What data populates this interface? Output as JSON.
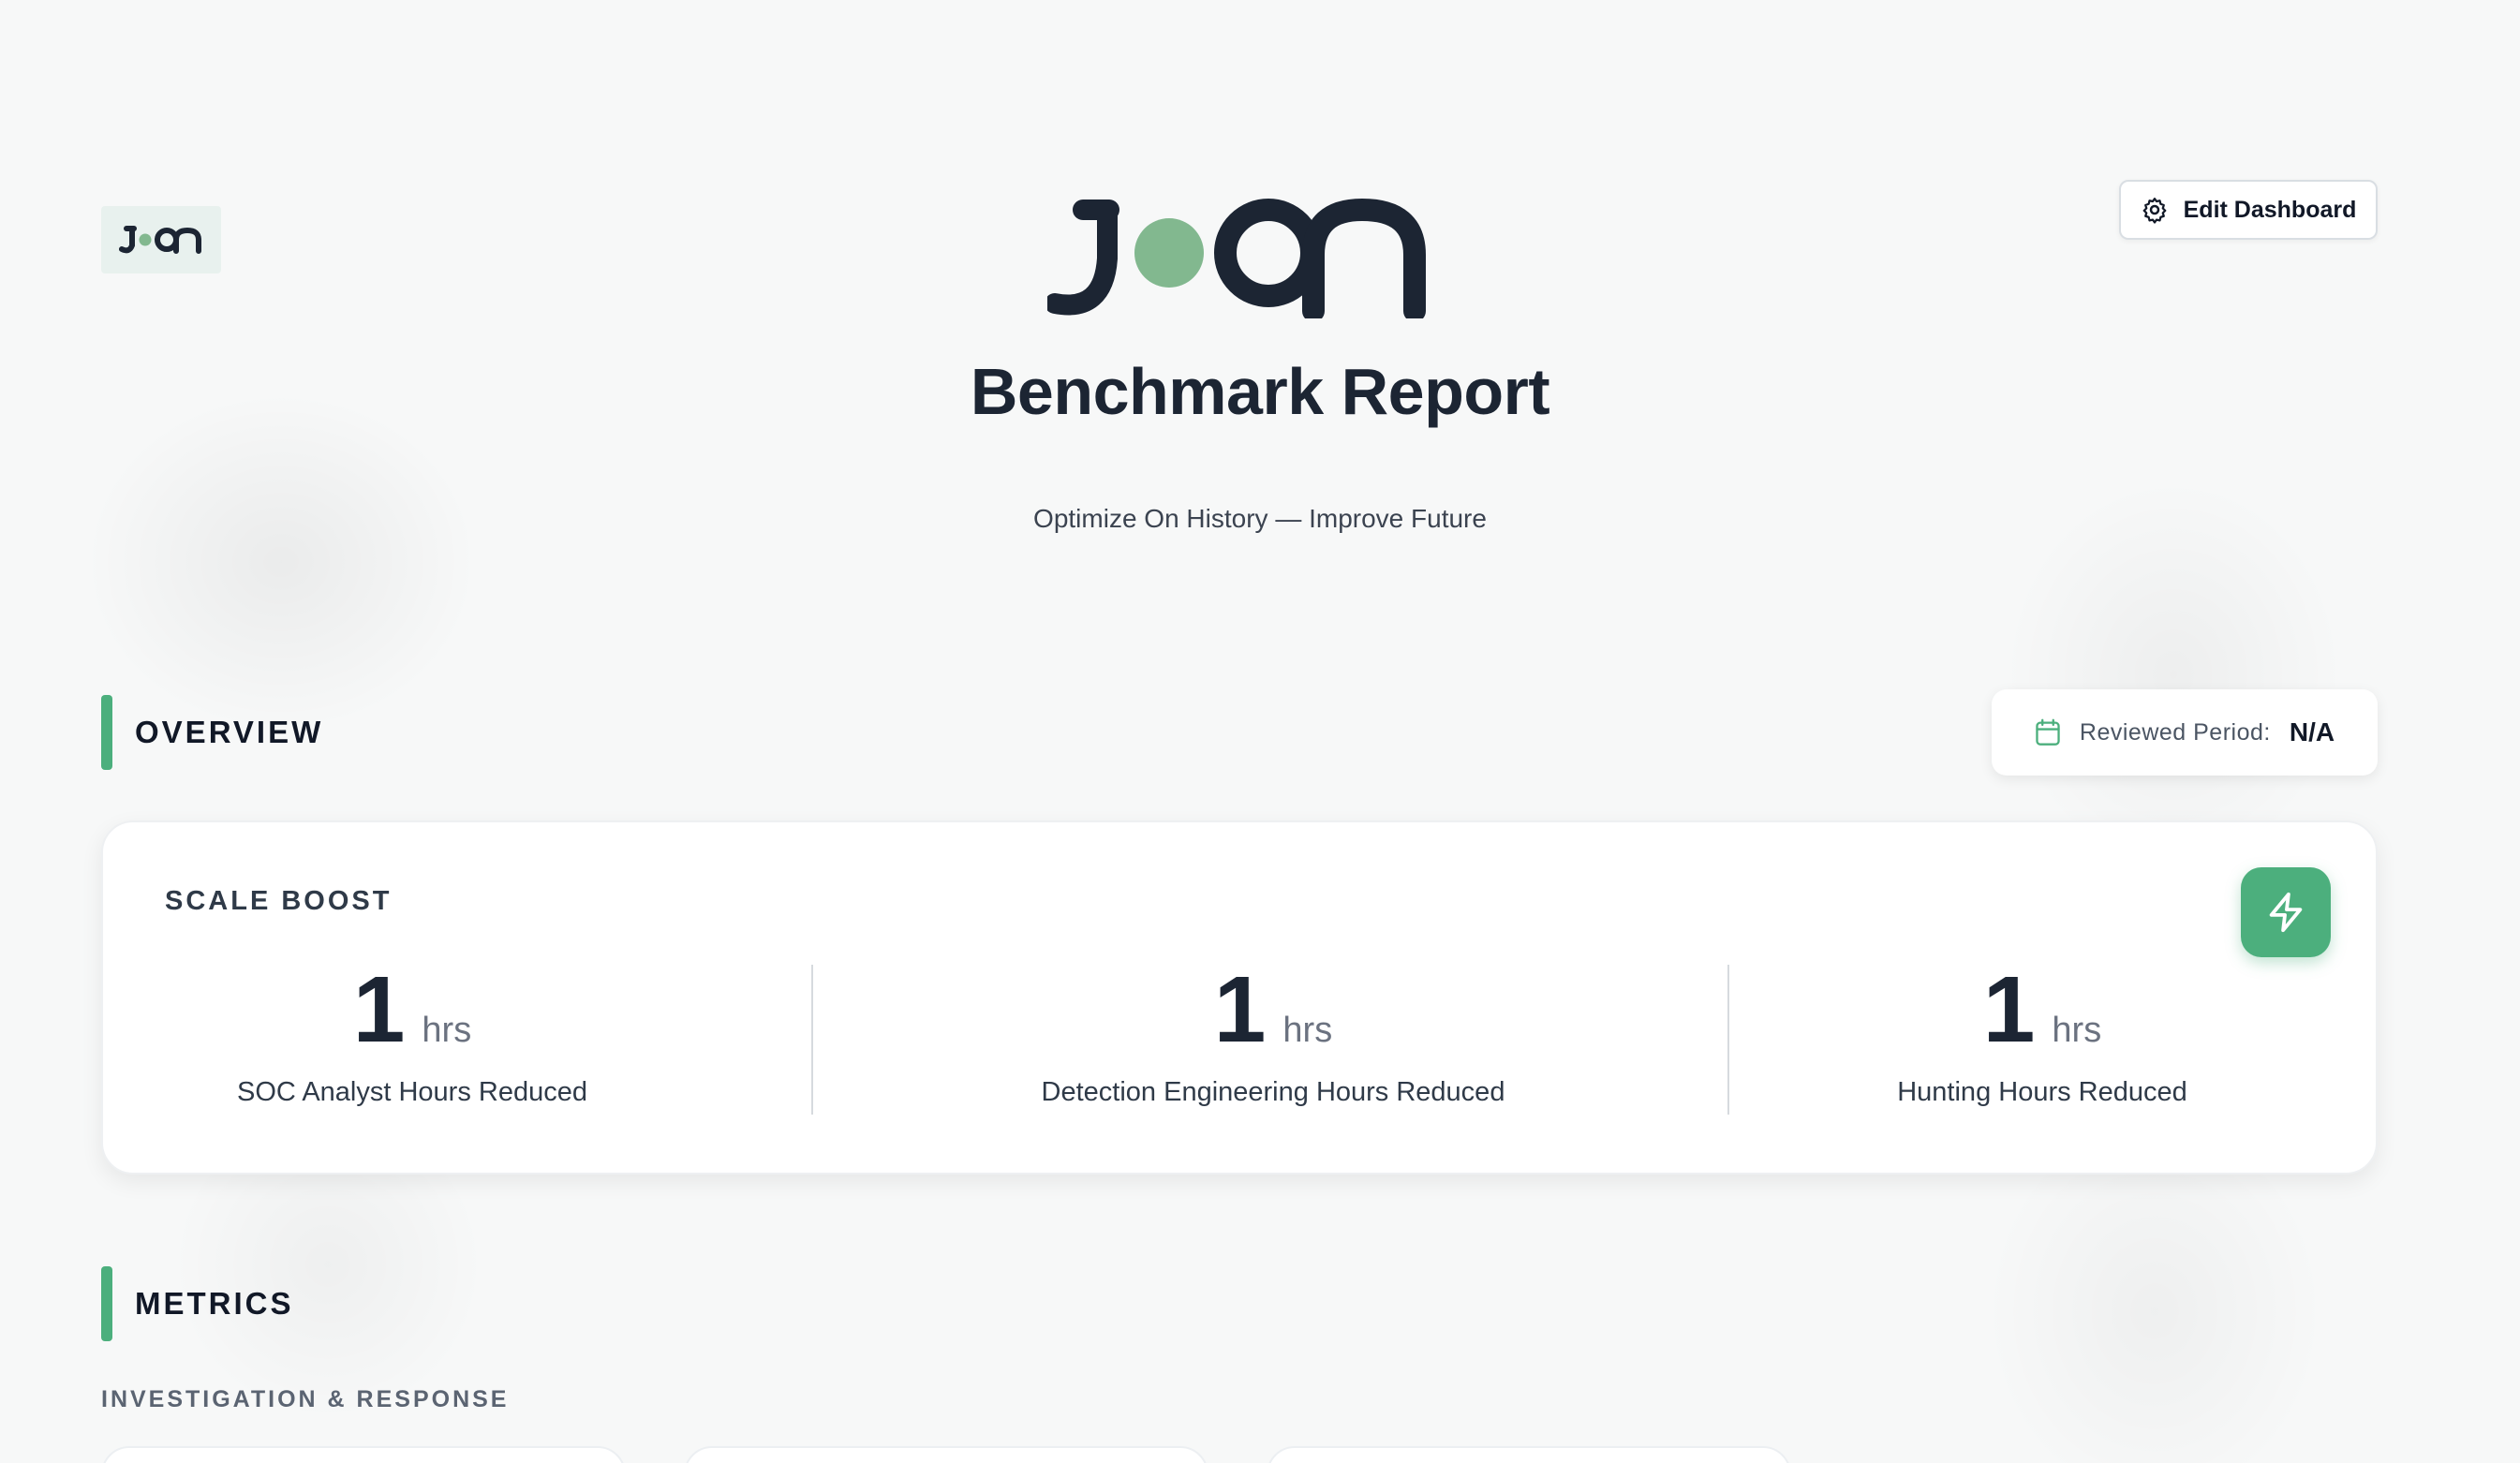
{
  "brand": {
    "logo_text": "Joon",
    "accent_color": "#4caf7d",
    "dark_color": "#1c2533"
  },
  "header": {
    "edit_button_label": "Edit Dashboard",
    "edit_button_icon": "gear-icon"
  },
  "hero": {
    "title": "Benchmark Report",
    "subtitle": "Optimize On History — Improve Future"
  },
  "overview": {
    "section_title": "OVERVIEW",
    "period_label": "Reviewed Period:",
    "period_value": "N/A",
    "period_icon": "calendar-icon"
  },
  "scale_boost": {
    "title": "SCALE BOOST",
    "action_icon": "lightning-icon",
    "stats": [
      {
        "value": "1",
        "unit": "hrs",
        "label": "SOC Analyst Hours Reduced"
      },
      {
        "value": "1",
        "unit": "hrs",
        "label": "Detection Engineering Hours Reduced"
      },
      {
        "value": "1",
        "unit": "hrs",
        "label": "Hunting Hours Reduced"
      }
    ]
  },
  "metrics": {
    "section_title": "METRICS",
    "subsection_title": "INVESTIGATION & RESPONSE"
  }
}
